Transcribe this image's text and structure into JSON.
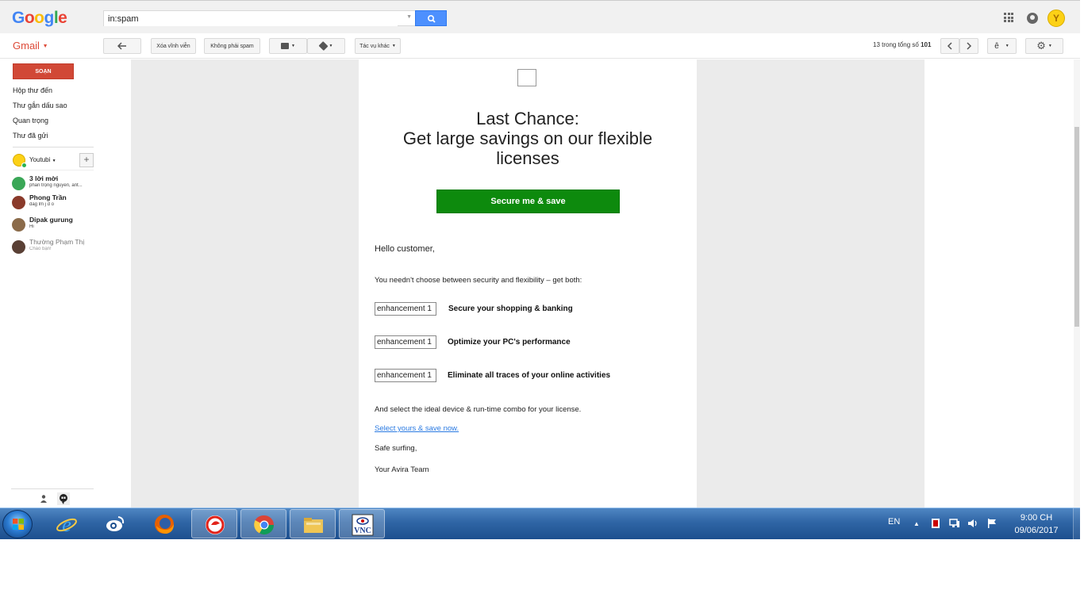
{
  "header": {
    "logo_letters": [
      "G",
      "o",
      "o",
      "g",
      "l",
      "e"
    ],
    "logo_colors": [
      "#4285f4",
      "#ea4335",
      "#fbbc05",
      "#4285f4",
      "#34a853",
      "#ea4335"
    ],
    "search_value": "in:spam",
    "avatar_letter": "Y"
  },
  "toolbar": {
    "app_label": "Gmail",
    "delete_forever": "Xóa vĩnh viễn",
    "not_spam": "Không phải spam",
    "more_label": "Tác vụ khác",
    "count_prefix": "13 trong tổng số",
    "count_total": "101",
    "input_tool": "ê"
  },
  "sidebar": {
    "compose": "SOẠN",
    "items": [
      "Hộp thư đến",
      "Thư gắn dấu sao",
      "Quan trọng",
      "Thư đã gửi"
    ],
    "hangout_user": "Youtubi",
    "contacts": [
      {
        "name": "3 lời mời",
        "msg": "phan trọng nguyễn, ant...",
        "color": "#3aa757"
      },
      {
        "name": "Phong Trần",
        "msg": "dag lm j d o",
        "color": "#8a3a2a"
      },
      {
        "name": "Dipak gurung",
        "msg": "Hi",
        "color": "#8b6b4a"
      },
      {
        "name": "Thường Phạm Thị",
        "msg": "Chào bạn!",
        "color": "#5a4035"
      }
    ]
  },
  "email": {
    "headline_line1": "Last Chance:",
    "headline_line2": "Get large savings on our flexible licenses",
    "cta": "Secure me & save",
    "greeting": "Hello customer,",
    "intro": "You needn't choose between security and flexibility – get both:",
    "features": [
      {
        "img_alt": "enhancement 1",
        "text": "Secure your shopping & banking"
      },
      {
        "img_alt": "enhancement 1",
        "text": "Optimize your PC's performance"
      },
      {
        "img_alt": "enhancement 1",
        "text": "Eliminate all traces of your online activities"
      }
    ],
    "select_text": "And select the ideal device & run-time combo for your license.",
    "select_link": "Select yours & save now.",
    "safe": "Safe surfing,",
    "team": "Your Avira Team"
  },
  "taskbar": {
    "lang": "EN",
    "time": "9:00 CH",
    "date": "09/06/2017",
    "apps": [
      "internet-explorer",
      "weibo",
      "firefox",
      "garena",
      "chrome",
      "file-explorer",
      "vnc"
    ]
  }
}
